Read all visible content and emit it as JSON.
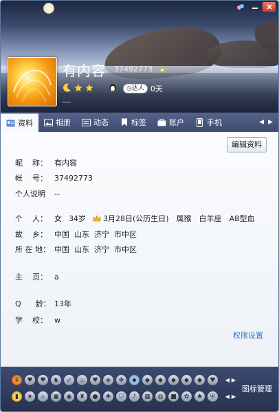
{
  "profile": {
    "nickname": "有内容",
    "qq_number": "37492773",
    "days": "0天",
    "badge": "达人",
    "signature": "---"
  },
  "window_buttons": [
    "skin-icon",
    "minimize-icon",
    "close-icon"
  ],
  "tabs": [
    {
      "label": "资料",
      "icon": "profile-card-icon",
      "active": true
    },
    {
      "label": "相册",
      "icon": "album-icon"
    },
    {
      "label": "动态",
      "icon": "feed-icon"
    },
    {
      "label": "标签",
      "icon": "tag-icon"
    },
    {
      "label": "账户",
      "icon": "wallet-icon"
    },
    {
      "label": "手机",
      "icon": "phone-icon"
    }
  ],
  "edit_button": "编辑资料",
  "fields": {
    "nickname": {
      "label": "昵    称：",
      "value": "有内容"
    },
    "account": {
      "label": "帐    号：",
      "value": "37492773"
    },
    "desc": {
      "label": "个人说明",
      "value": "--"
    },
    "personal": {
      "label": "个    人：",
      "gender": "女",
      "age": "34岁",
      "birthday": "3月28日(公历生日)",
      "zodiac": "属猴",
      "sign": "白羊座",
      "blood": "AB型血"
    },
    "hometown": {
      "label": "故    乡：",
      "value": "中国  山东  济宁  市中区"
    },
    "location": {
      "label": "所 在 地：",
      "value": "中国  山东  济宁  市中区"
    },
    "homepage": {
      "label": "主    页：",
      "value": "a"
    },
    "qage": {
      "label": "Q      龄：",
      "value": "13年"
    },
    "school": {
      "label": "学    校：",
      "value": "w"
    }
  },
  "permission_link": "权限设置",
  "icon_manager": "图标管理",
  "colors": {
    "accent": "#3a78c8",
    "tab_bar": "#4a5780",
    "bottom_bar": "#2f3a5a"
  }
}
